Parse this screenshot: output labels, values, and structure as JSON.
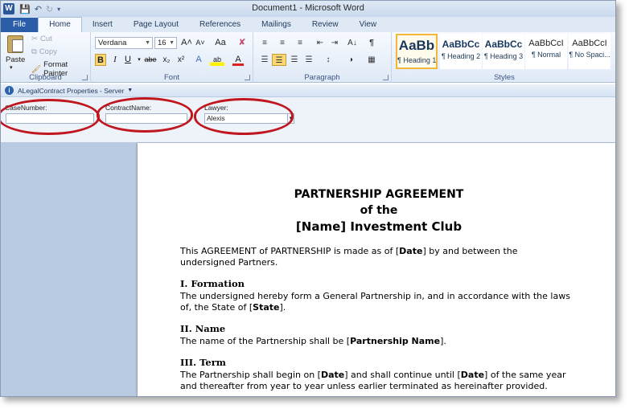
{
  "window": {
    "title": "Document1 - Microsoft Word"
  },
  "tabs": [
    "File",
    "Home",
    "Insert",
    "Page Layout",
    "References",
    "Mailings",
    "Review",
    "View"
  ],
  "ribbon": {
    "clipboard": {
      "label": "Clipboard",
      "paste": "Paste",
      "cut": "Cut",
      "copy": "Copy",
      "format_painter": "Format Painter"
    },
    "font": {
      "label": "Font",
      "font_name": "Verdana",
      "font_size": "16",
      "bold": "B",
      "italic": "I",
      "underline": "U",
      "strike": "abe",
      "subscript": "x₂",
      "superscript": "x²",
      "grow": "A˄",
      "shrink": "A˅",
      "change_case": "Aa",
      "clear": "✘",
      "text_effects": "A",
      "highlight": "ab",
      "font_color": "A"
    },
    "paragraph": {
      "label": "Paragraph",
      "pilcrow": "¶",
      "sort": "A↓"
    },
    "styles": {
      "label": "Styles",
      "items": [
        {
          "preview": "AaBb",
          "name": "¶ Heading 1"
        },
        {
          "preview": "AaBbCc",
          "name": "¶ Heading 2"
        },
        {
          "preview": "AaBbCc",
          "name": "¶ Heading 3"
        },
        {
          "preview": "AaBbCcI",
          "name": "¶ Normal"
        },
        {
          "preview": "AaBbCcI",
          "name": "¶ No Spaci..."
        }
      ]
    }
  },
  "docinfo": {
    "bar_title": "ALegalContract Properties - Server",
    "fields": [
      {
        "label": "CaseNumber:",
        "value": ""
      },
      {
        "label": "ContractName:",
        "value": ""
      },
      {
        "label": "Lawyer:",
        "value": "Alexis"
      }
    ]
  },
  "document": {
    "title_1": "PARTNERSHIP  AGREEMENT",
    "title_2": "of the",
    "title_3": "[Name]  Investment Club",
    "intro_a": "This AGREEMENT of PARTNERSHIP is made as of [",
    "intro_b": "Date",
    "intro_c": "]  by and between the",
    "intro_d": "undersigned Partners.",
    "s1_heading": "I. Formation",
    "s1_a": "The undersigned hereby form a General Partnership in, and in accordance with the laws",
    "s1_b": "of, the State of [",
    "s1_c": "State",
    "s1_d": "].",
    "s2_heading": "II. Name",
    "s2_a": "The name of the Partnership shall be [",
    "s2_b": "Partnership Name",
    "s2_c": "].",
    "s3_heading": "III. Term",
    "s3_a": "The Partnership shall begin on [",
    "s3_b": "Date",
    "s3_c": "] and shall continue until [",
    "s3_d": "Date",
    "s3_e": "] of the same year",
    "s3_f": "and thereafter from year to year unless earlier terminated as hereinafter provided."
  }
}
